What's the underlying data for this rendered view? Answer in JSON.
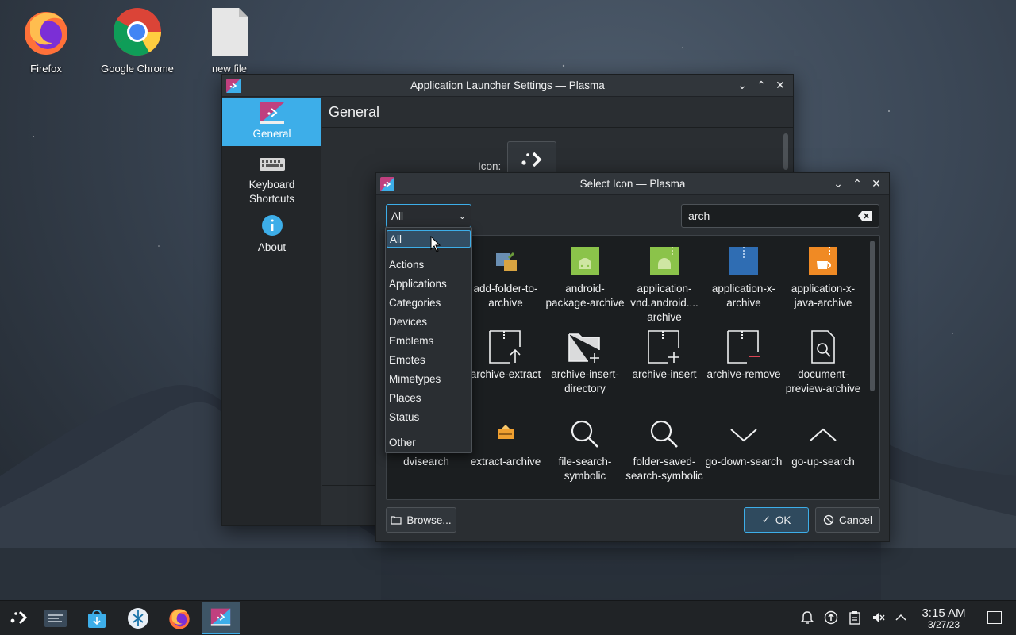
{
  "desktop": {
    "icons": [
      {
        "label": "Firefox"
      },
      {
        "label": "Google Chrome"
      },
      {
        "label": "new file"
      }
    ]
  },
  "settings_window": {
    "title": "Application Launcher Settings — Plasma",
    "sidebar": [
      {
        "label": "General",
        "icon": "application-launcher-icon",
        "active": true
      },
      {
        "label": "Keyboard\nShortcuts",
        "icon": "keyboard-icon"
      },
      {
        "label": "About",
        "icon": "info-icon"
      }
    ],
    "page_title": "General",
    "icon_label": "Icon:"
  },
  "dialog": {
    "title": "Select Icon — Plasma",
    "category_value": "All",
    "search_value": "arch",
    "icons": [
      {
        "label": "",
        "icon": "hidden-icon"
      },
      {
        "label": "add-folder-to-archive",
        "icon": "add-folder-to-archive-icon"
      },
      {
        "label": "android-package-archive",
        "icon": "android-package-icon"
      },
      {
        "label": "application-vnd.android.... archive",
        "icon": "android-archive-icon"
      },
      {
        "label": "application-x-archive",
        "icon": "zip-archive-icon"
      },
      {
        "label": "application-x-java-archive",
        "icon": "java-archive-icon"
      },
      {
        "label": "",
        "icon": "hidden-icon"
      },
      {
        "label": "archive-extract",
        "icon": "archive-extract-icon"
      },
      {
        "label": "archive-insert-directory",
        "icon": "archive-insert-directory-icon"
      },
      {
        "label": "archive-insert",
        "icon": "archive-insert-icon"
      },
      {
        "label": "archive-remove",
        "icon": "archive-remove-icon"
      },
      {
        "label": "document-preview-archive",
        "icon": "document-preview-icon"
      },
      {
        "label": "dvisearch",
        "icon": "dvisearch-icon"
      },
      {
        "label": "extract-archive",
        "icon": "extract-archive-icon"
      },
      {
        "label": "file-search-symbolic",
        "icon": "search-icon"
      },
      {
        "label": "folder-saved-search-symbolic",
        "icon": "search-icon"
      },
      {
        "label": "go-down-search",
        "icon": "chevron-down-icon"
      },
      {
        "label": "go-up-search",
        "icon": "chevron-up-icon"
      }
    ],
    "browse_label": "Browse...",
    "ok_label": "OK",
    "cancel_label": "Cancel"
  },
  "dropdown": {
    "items": [
      "All",
      "Actions",
      "Applications",
      "Categories",
      "Devices",
      "Emblems",
      "Emotes",
      "Mimetypes",
      "Places",
      "Status",
      "Other"
    ],
    "selected": "All"
  },
  "taskbar": {
    "items": [
      "application-launcher-icon",
      "task-manager-icon",
      "discover-store-icon",
      "steam-deck-icon",
      "firefox-icon",
      "settings-window-icon"
    ],
    "tray": [
      "notifications-icon",
      "update-icon",
      "clipboard-icon",
      "volume-muted-icon",
      "chevron-up-icon"
    ],
    "time": "3:15 AM",
    "date": "3/27/23"
  },
  "colors": {
    "accent": "#3daee9",
    "window_bg": "#2a2e32",
    "titlebar": "#31363b"
  }
}
